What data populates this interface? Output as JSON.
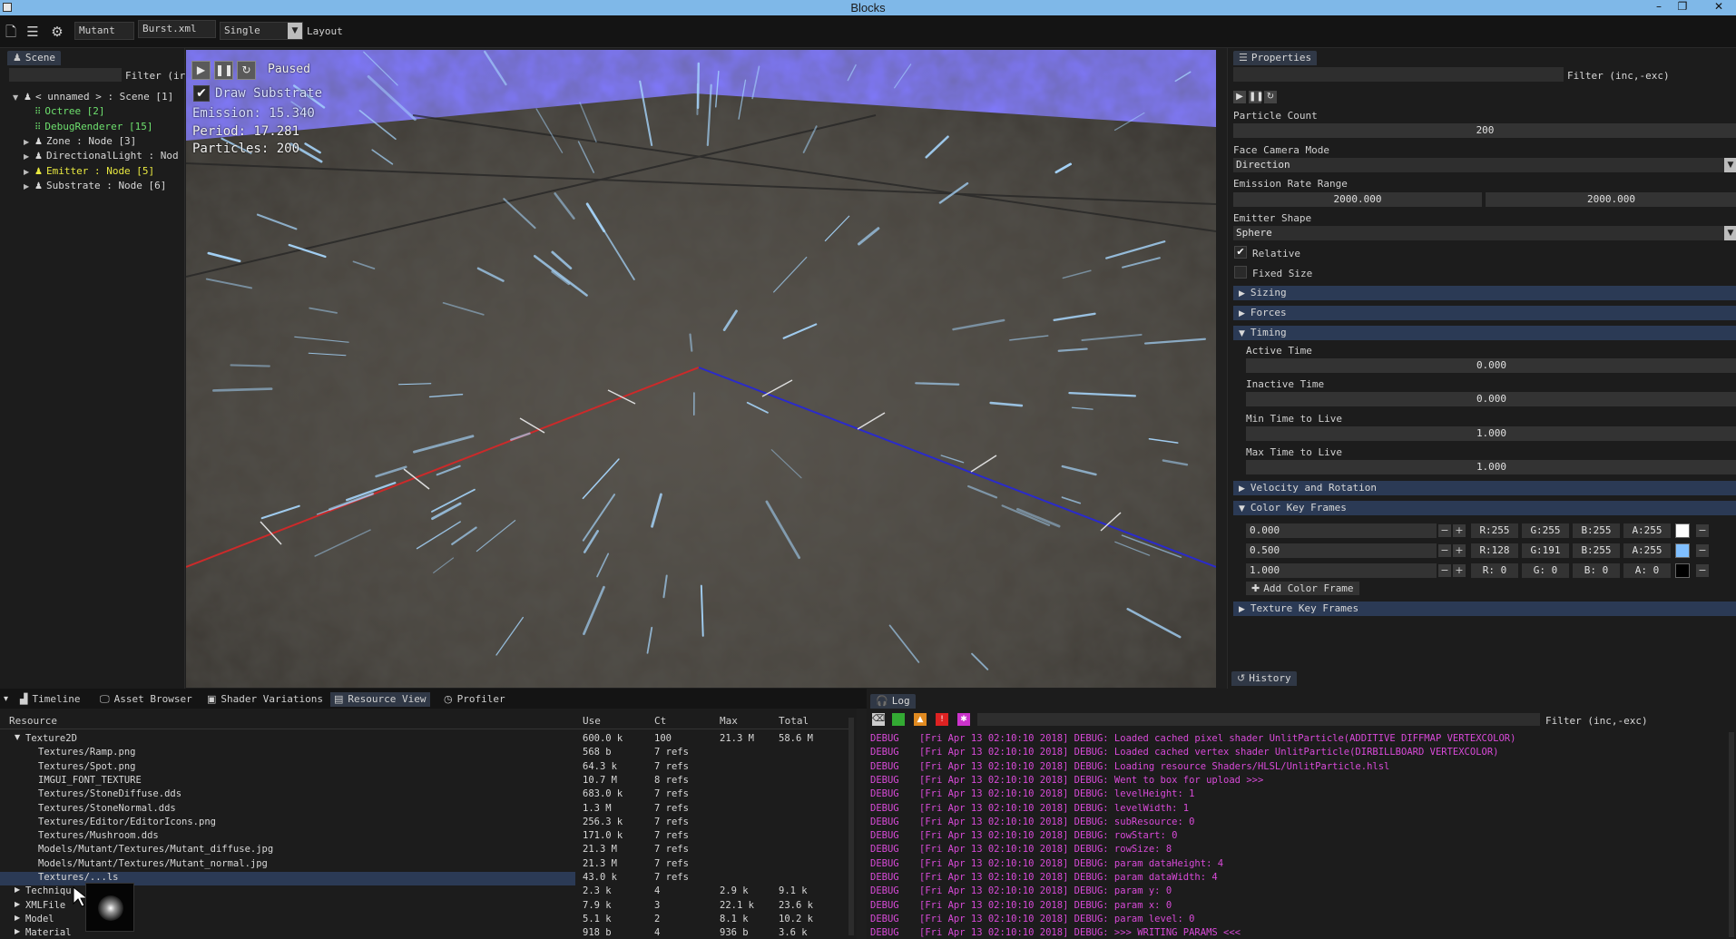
{
  "window": {
    "title": "Blocks"
  },
  "toolbar": {
    "model_field": "Mutant",
    "file_field": "Burst.xml",
    "mode_select": "Single",
    "layout_label": "Layout"
  },
  "scene": {
    "tab_label": "Scene",
    "filter_placeholder": "Filter (inc,-exc)",
    "filter_label": "Filter (ir",
    "tree": [
      {
        "label": "< unnamed > : Scene [1]",
        "color": "#d8d8d8",
        "arrow": "▼",
        "icon": "node",
        "indent": 0
      },
      {
        "label": "Octree [2]",
        "color": "#6ee06e",
        "arrow": "",
        "icon": "grid",
        "indent": 1
      },
      {
        "label": "DebugRenderer [15]",
        "color": "#6ee06e",
        "arrow": "",
        "icon": "grid",
        "indent": 1
      },
      {
        "label": "Zone : Node [3]",
        "color": "#d8d8d8",
        "arrow": "▶",
        "icon": "node",
        "indent": 1
      },
      {
        "label": "DirectionalLight : Nod",
        "color": "#d8d8d8",
        "arrow": "▶",
        "icon": "node",
        "indent": 1
      },
      {
        "label": "Emitter : Node [5]",
        "color": "#e8e840",
        "arrow": "▶",
        "icon": "node",
        "indent": 1
      },
      {
        "label": "Substrate : Node [6]",
        "color": "#d8d8d8",
        "arrow": "▶",
        "icon": "node",
        "indent": 1
      }
    ]
  },
  "viewport": {
    "status": "Paused",
    "draw_substrate_label": "Draw Substrate",
    "emission": "Emission: 15.340",
    "period": "Period: 17.281",
    "particles": "Particles: 200"
  },
  "properties": {
    "tab_label": "Properties",
    "filter_label": "Filter (inc,-exc)",
    "particle_count_label": "Particle Count",
    "particle_count": "200",
    "face_camera_label": "Face Camera Mode",
    "face_camera_value": "Direction",
    "emission_rate_label": "Emission Rate Range",
    "emission_rate_min": "2000.000",
    "emission_rate_max": "2000.000",
    "emitter_shape_label": "Emitter Shape",
    "emitter_shape_value": "Sphere",
    "relative_label": "Relative",
    "relative_checked": true,
    "fixed_size_label": "Fixed Size",
    "fixed_size_checked": false,
    "sections": {
      "sizing": "Sizing",
      "forces": "Forces",
      "timing": "Timing",
      "velocity": "Velocity and Rotation",
      "color_key_frames": "Color Key Frames",
      "texture_key_frames": "Texture Key Frames"
    },
    "timing": {
      "active_time_label": "Active Time",
      "active_time": "0.000",
      "inactive_time_label": "Inactive Time",
      "inactive_time": "0.000",
      "min_ttl_label": "Min Time to Live",
      "min_ttl": "1.000",
      "max_ttl_label": "Max Time to Live",
      "max_ttl": "1.000"
    },
    "color_frames": [
      {
        "time": "0.000",
        "r": "R:255",
        "g": "G:255",
        "b": "B:255",
        "a": "A:255",
        "swatch": "#ffffff"
      },
      {
        "time": "0.500",
        "r": "R:128",
        "g": "G:191",
        "b": "B:255",
        "a": "A:255",
        "swatch": "#80bfff"
      },
      {
        "time": "1.000",
        "r": "R:  0",
        "g": "G:  0",
        "b": "B:  0",
        "a": "A:  0",
        "swatch": "#000000"
      }
    ],
    "add_color_frame": "Add Color Frame",
    "history_tab": "History"
  },
  "bottom_tabs": [
    {
      "label": "Timeline",
      "icon": "chart-icon"
    },
    {
      "label": "Asset Browser",
      "icon": "monitor-icon"
    },
    {
      "label": "Shader Variations",
      "icon": "image-icon"
    },
    {
      "label": "Resource View",
      "icon": "resource-icon"
    },
    {
      "label": "Profiler",
      "icon": "clock-icon"
    }
  ],
  "resource_view": {
    "headers": {
      "resource": "Resource",
      "use": "Use",
      "ct": "Ct",
      "max": "Max",
      "total": "Total"
    },
    "rows": [
      {
        "name": "Texture2D",
        "use": "600.0 k",
        "ct": "100",
        "max": "21.3 M",
        "total": "58.6 M",
        "arrow": "▼",
        "indent": 1,
        "selected": false
      },
      {
        "name": "Textures/Ramp.png",
        "use": "568 b",
        "ct": "7 refs",
        "max": "",
        "total": "",
        "arrow": "",
        "indent": 2,
        "selected": false
      },
      {
        "name": "Textures/Spot.png",
        "use": "64.3 k",
        "ct": "7 refs",
        "max": "",
        "total": "",
        "arrow": "",
        "indent": 2,
        "selected": false
      },
      {
        "name": "IMGUI_FONT_TEXTURE",
        "use": "10.7 M",
        "ct": "8 refs",
        "max": "",
        "total": "",
        "arrow": "",
        "indent": 2,
        "selected": false
      },
      {
        "name": "Textures/StoneDiffuse.dds",
        "use": "683.0 k",
        "ct": "7 refs",
        "max": "",
        "total": "",
        "arrow": "",
        "indent": 2,
        "selected": false
      },
      {
        "name": "Textures/StoneNormal.dds",
        "use": "1.3 M",
        "ct": "7 refs",
        "max": "",
        "total": "",
        "arrow": "",
        "indent": 2,
        "selected": false
      },
      {
        "name": "Textures/Editor/EditorIcons.png",
        "use": "256.3 k",
        "ct": "7 refs",
        "max": "",
        "total": "",
        "arrow": "",
        "indent": 2,
        "selected": false
      },
      {
        "name": "Textures/Mushroom.dds",
        "use": "171.0 k",
        "ct": "7 refs",
        "max": "",
        "total": "",
        "arrow": "",
        "indent": 2,
        "selected": false
      },
      {
        "name": "Models/Mutant/Textures/Mutant_diffuse.jpg",
        "use": "21.3 M",
        "ct": "7 refs",
        "max": "",
        "total": "",
        "arrow": "",
        "indent": 2,
        "selected": false
      },
      {
        "name": "Models/Mutant/Textures/Mutant_normal.jpg",
        "use": "21.3 M",
        "ct": "7 refs",
        "max": "",
        "total": "",
        "arrow": "",
        "indent": 2,
        "selected": false
      },
      {
        "name": "Textures/...ls",
        "use": "43.0 k",
        "ct": "7 refs",
        "max": "",
        "total": "",
        "arrow": "",
        "indent": 2,
        "selected": true
      },
      {
        "name": "Techniqu",
        "use": "2.3 k",
        "ct": "4",
        "max": "2.9 k",
        "total": "9.1 k",
        "arrow": "▶",
        "indent": 1,
        "selected": false
      },
      {
        "name": "XMLFile",
        "use": "7.9 k",
        "ct": "3",
        "max": "22.1 k",
        "total": "23.6 k",
        "arrow": "▶",
        "indent": 1,
        "selected": false
      },
      {
        "name": "Model",
        "use": "5.1 k",
        "ct": "2",
        "max": "8.1 k",
        "total": "10.2 k",
        "arrow": "▶",
        "indent": 1,
        "selected": false
      },
      {
        "name": "Material",
        "use": "918 b",
        "ct": "4",
        "max": "936 b",
        "total": "3.6 k",
        "arrow": "▶",
        "indent": 1,
        "selected": false
      }
    ]
  },
  "log": {
    "tab_label": "Log",
    "filter_label": "Filter (inc,-exc)",
    "lines": [
      {
        "level": "DEBUG",
        "msg": "[Fri Apr 13 02:10:10 2018] DEBUG: Loaded cached pixel shader UnlitParticle(ADDITIVE DIFFMAP VERTEXCOLOR)"
      },
      {
        "level": "DEBUG",
        "msg": "[Fri Apr 13 02:10:10 2018] DEBUG: Loaded cached vertex shader UnlitParticle(DIRBILLBOARD VERTEXCOLOR)"
      },
      {
        "level": "DEBUG",
        "msg": "[Fri Apr 13 02:10:10 2018] DEBUG: Loading resource Shaders/HLSL/UnlitParticle.hlsl"
      },
      {
        "level": "DEBUG",
        "msg": "[Fri Apr 13 02:10:10 2018] DEBUG: Went to box for upload >>>"
      },
      {
        "level": "DEBUG",
        "msg": "[Fri Apr 13 02:10:10 2018] DEBUG: levelHeight: 1"
      },
      {
        "level": "DEBUG",
        "msg": "[Fri Apr 13 02:10:10 2018] DEBUG: levelWidth: 1"
      },
      {
        "level": "DEBUG",
        "msg": "[Fri Apr 13 02:10:10 2018] DEBUG: subResource: 0"
      },
      {
        "level": "DEBUG",
        "msg": "[Fri Apr 13 02:10:10 2018] DEBUG: rowStart: 0"
      },
      {
        "level": "DEBUG",
        "msg": "[Fri Apr 13 02:10:10 2018] DEBUG: rowSize: 8"
      },
      {
        "level": "DEBUG",
        "msg": "[Fri Apr 13 02:10:10 2018] DEBUG: param dataHeight: 4"
      },
      {
        "level": "DEBUG",
        "msg": "[Fri Apr 13 02:10:10 2018] DEBUG: param dataWidth: 4"
      },
      {
        "level": "DEBUG",
        "msg": "[Fri Apr 13 02:10:10 2018] DEBUG: param y: 0"
      },
      {
        "level": "DEBUG",
        "msg": "[Fri Apr 13 02:10:10 2018] DEBUG: param x: 0"
      },
      {
        "level": "DEBUG",
        "msg": "[Fri Apr 13 02:10:10 2018] DEBUG: param level: 0"
      },
      {
        "level": "DEBUG",
        "msg": "[Fri Apr 13 02:10:10 2018] DEBUG: >>> WRITING PARAMS <<<"
      }
    ]
  },
  "colors": {
    "sky": "#8a7cff",
    "ground": "#4a4640",
    "axis_x": "#cc2a2a",
    "axis_z": "#2a2acc",
    "log_text": "#d84ad8",
    "header_bg": "#2b3a55"
  }
}
